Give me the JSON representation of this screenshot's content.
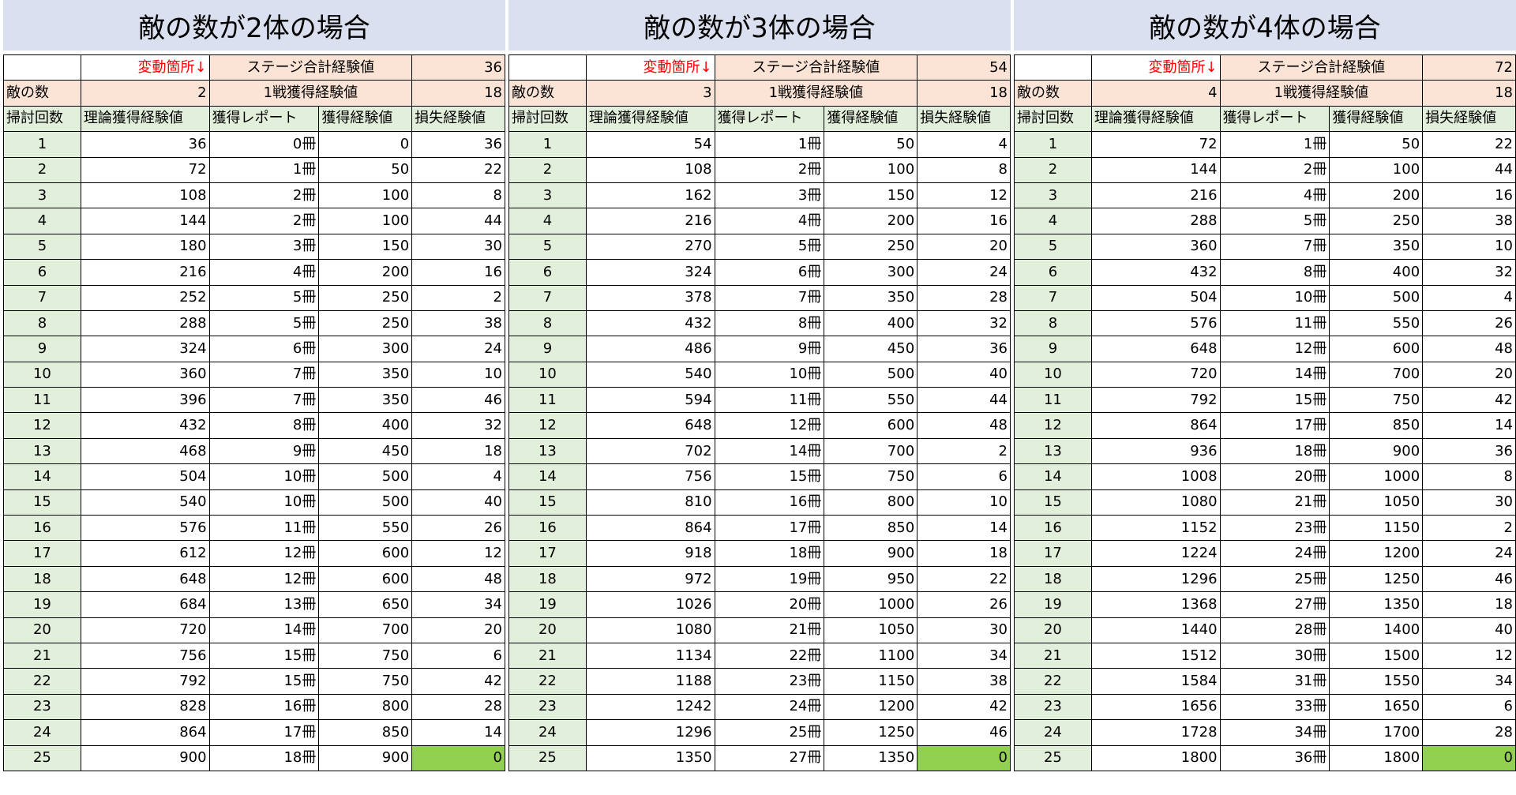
{
  "labels": {
    "note": "変動箇所↓",
    "stage_total": "ステージ合計経験値",
    "battle_exp": "1戦獲得経験値",
    "enemy_count": "敵の数",
    "col_sweep": "掃討回数",
    "col_theory": "理論獲得経験値",
    "col_reports": "獲得レポート",
    "col_exp": "獲得経験値",
    "col_loss": "損失経験値"
  },
  "highlight_color": "#92d050",
  "panels": [
    {
      "title": "敵の数が2体の場合",
      "stage_total": "36",
      "enemy_count": "2",
      "battle_exp": "18",
      "rows": [
        [
          "1",
          "36",
          "0冊",
          "0",
          "36"
        ],
        [
          "2",
          "72",
          "1冊",
          "50",
          "22"
        ],
        [
          "3",
          "108",
          "2冊",
          "100",
          "8"
        ],
        [
          "4",
          "144",
          "2冊",
          "100",
          "44"
        ],
        [
          "5",
          "180",
          "3冊",
          "150",
          "30"
        ],
        [
          "6",
          "216",
          "4冊",
          "200",
          "16"
        ],
        [
          "7",
          "252",
          "5冊",
          "250",
          "2"
        ],
        [
          "8",
          "288",
          "5冊",
          "250",
          "38"
        ],
        [
          "9",
          "324",
          "6冊",
          "300",
          "24"
        ],
        [
          "10",
          "360",
          "7冊",
          "350",
          "10"
        ],
        [
          "11",
          "396",
          "7冊",
          "350",
          "46"
        ],
        [
          "12",
          "432",
          "8冊",
          "400",
          "32"
        ],
        [
          "13",
          "468",
          "9冊",
          "450",
          "18"
        ],
        [
          "14",
          "504",
          "10冊",
          "500",
          "4"
        ],
        [
          "15",
          "540",
          "10冊",
          "500",
          "40"
        ],
        [
          "16",
          "576",
          "11冊",
          "550",
          "26"
        ],
        [
          "17",
          "612",
          "12冊",
          "600",
          "12"
        ],
        [
          "18",
          "648",
          "12冊",
          "600",
          "48"
        ],
        [
          "19",
          "684",
          "13冊",
          "650",
          "34"
        ],
        [
          "20",
          "720",
          "14冊",
          "700",
          "20"
        ],
        [
          "21",
          "756",
          "15冊",
          "750",
          "6"
        ],
        [
          "22",
          "792",
          "15冊",
          "750",
          "42"
        ],
        [
          "23",
          "828",
          "16冊",
          "800",
          "28"
        ],
        [
          "24",
          "864",
          "17冊",
          "850",
          "14"
        ],
        [
          "25",
          "900",
          "18冊",
          "900",
          "0"
        ]
      ]
    },
    {
      "title": "敵の数が3体の場合",
      "stage_total": "54",
      "enemy_count": "3",
      "battle_exp": "18",
      "rows": [
        [
          "1",
          "54",
          "1冊",
          "50",
          "4"
        ],
        [
          "2",
          "108",
          "2冊",
          "100",
          "8"
        ],
        [
          "3",
          "162",
          "3冊",
          "150",
          "12"
        ],
        [
          "4",
          "216",
          "4冊",
          "200",
          "16"
        ],
        [
          "5",
          "270",
          "5冊",
          "250",
          "20"
        ],
        [
          "6",
          "324",
          "6冊",
          "300",
          "24"
        ],
        [
          "7",
          "378",
          "7冊",
          "350",
          "28"
        ],
        [
          "8",
          "432",
          "8冊",
          "400",
          "32"
        ],
        [
          "9",
          "486",
          "9冊",
          "450",
          "36"
        ],
        [
          "10",
          "540",
          "10冊",
          "500",
          "40"
        ],
        [
          "11",
          "594",
          "11冊",
          "550",
          "44"
        ],
        [
          "12",
          "648",
          "12冊",
          "600",
          "48"
        ],
        [
          "13",
          "702",
          "14冊",
          "700",
          "2"
        ],
        [
          "14",
          "756",
          "15冊",
          "750",
          "6"
        ],
        [
          "15",
          "810",
          "16冊",
          "800",
          "10"
        ],
        [
          "16",
          "864",
          "17冊",
          "850",
          "14"
        ],
        [
          "17",
          "918",
          "18冊",
          "900",
          "18"
        ],
        [
          "18",
          "972",
          "19冊",
          "950",
          "22"
        ],
        [
          "19",
          "1026",
          "20冊",
          "1000",
          "26"
        ],
        [
          "20",
          "1080",
          "21冊",
          "1050",
          "30"
        ],
        [
          "21",
          "1134",
          "22冊",
          "1100",
          "34"
        ],
        [
          "22",
          "1188",
          "23冊",
          "1150",
          "38"
        ],
        [
          "23",
          "1242",
          "24冊",
          "1200",
          "42"
        ],
        [
          "24",
          "1296",
          "25冊",
          "1250",
          "46"
        ],
        [
          "25",
          "1350",
          "27冊",
          "1350",
          "0"
        ]
      ]
    },
    {
      "title": "敵の数が4体の場合",
      "stage_total": "72",
      "enemy_count": "4",
      "battle_exp": "18",
      "rows": [
        [
          "1",
          "72",
          "1冊",
          "50",
          "22"
        ],
        [
          "2",
          "144",
          "2冊",
          "100",
          "44"
        ],
        [
          "3",
          "216",
          "4冊",
          "200",
          "16"
        ],
        [
          "4",
          "288",
          "5冊",
          "250",
          "38"
        ],
        [
          "5",
          "360",
          "7冊",
          "350",
          "10"
        ],
        [
          "6",
          "432",
          "8冊",
          "400",
          "32"
        ],
        [
          "7",
          "504",
          "10冊",
          "500",
          "4"
        ],
        [
          "8",
          "576",
          "11冊",
          "550",
          "26"
        ],
        [
          "9",
          "648",
          "12冊",
          "600",
          "48"
        ],
        [
          "10",
          "720",
          "14冊",
          "700",
          "20"
        ],
        [
          "11",
          "792",
          "15冊",
          "750",
          "42"
        ],
        [
          "12",
          "864",
          "17冊",
          "850",
          "14"
        ],
        [
          "13",
          "936",
          "18冊",
          "900",
          "36"
        ],
        [
          "14",
          "1008",
          "20冊",
          "1000",
          "8"
        ],
        [
          "15",
          "1080",
          "21冊",
          "1050",
          "30"
        ],
        [
          "16",
          "1152",
          "23冊",
          "1150",
          "2"
        ],
        [
          "17",
          "1224",
          "24冊",
          "1200",
          "24"
        ],
        [
          "18",
          "1296",
          "25冊",
          "1250",
          "46"
        ],
        [
          "19",
          "1368",
          "27冊",
          "1350",
          "18"
        ],
        [
          "20",
          "1440",
          "28冊",
          "1400",
          "40"
        ],
        [
          "21",
          "1512",
          "30冊",
          "1500",
          "12"
        ],
        [
          "22",
          "1584",
          "31冊",
          "1550",
          "34"
        ],
        [
          "23",
          "1656",
          "33冊",
          "1650",
          "6"
        ],
        [
          "24",
          "1728",
          "34冊",
          "1700",
          "28"
        ],
        [
          "25",
          "1800",
          "36冊",
          "1800",
          "0"
        ]
      ]
    }
  ]
}
